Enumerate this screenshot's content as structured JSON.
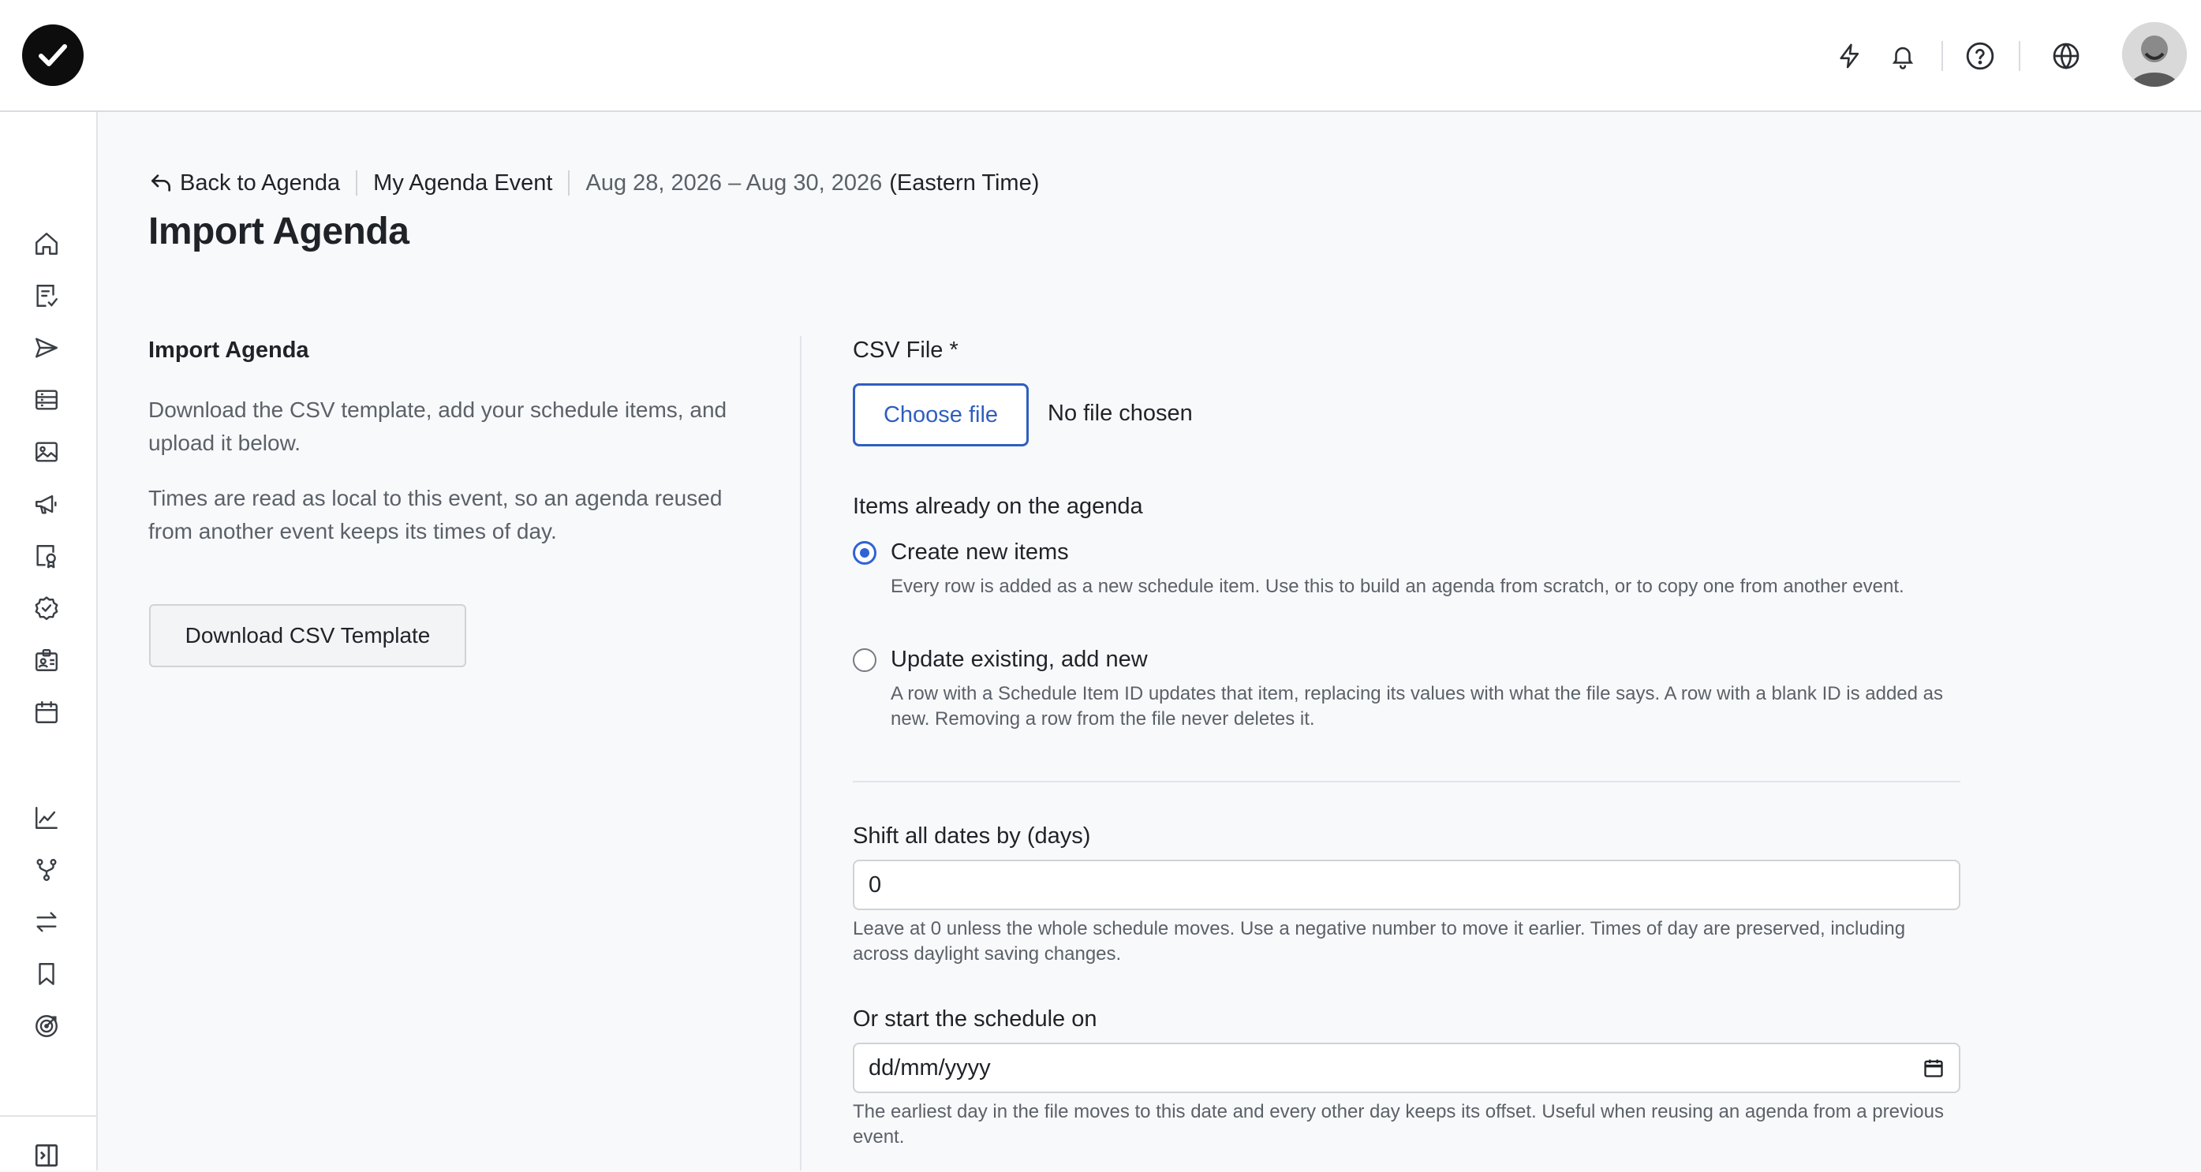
{
  "header": {
    "icons": [
      "lightning-icon",
      "bell-icon",
      "help-circle-icon",
      "globe-icon"
    ]
  },
  "breadcrumb": {
    "back_label": "Back to Agenda",
    "event_name": "My Agenda Event",
    "dates": "Aug 28, 2026 – Aug 30, 2026",
    "timezone": "(Eastern Time)"
  },
  "page_title": "Import Agenda",
  "left": {
    "section_title": "Import Agenda",
    "paragraph1": "Download the CSV template, add your schedule items, and upload it below.",
    "paragraph2": "Times are read as local to this event, so an agenda reused from another event keeps its times of day.",
    "download_button": "Download CSV Template"
  },
  "form": {
    "csv_label": "CSV File *",
    "choose_file_label": "Choose file",
    "no_file_text": "No file chosen",
    "items_label": "Items already on the agenda",
    "options": [
      {
        "label": "Create new items",
        "description": "Every row is added as a new schedule item. Use this to build an agenda from scratch, or to copy one from another event.",
        "checked": true
      },
      {
        "label": "Update existing, add new",
        "description": "A row with a Schedule Item ID updates that item, replacing its values with what the file says. A row with a blank ID is added as new. Removing a row from the file never deletes it.",
        "checked": false
      }
    ],
    "shift_label": "Shift all dates by (days)",
    "shift_value": "0",
    "shift_help": "Leave at 0 unless the whole schedule moves. Use a negative number to move it earlier. Times of day are preserved, including across daylight saving changes.",
    "start_label": "Or start the schedule on",
    "start_placeholder": "dd/mm/yyyy",
    "start_help": "The earliest day in the file moves to this date and every other day keeps its offset. Useful when reusing an agenda from a previous event."
  },
  "colors": {
    "accent": "#2f5fbf",
    "radio_selected": "#2f63d3",
    "text": "#1f2328",
    "muted": "#5b6168"
  }
}
